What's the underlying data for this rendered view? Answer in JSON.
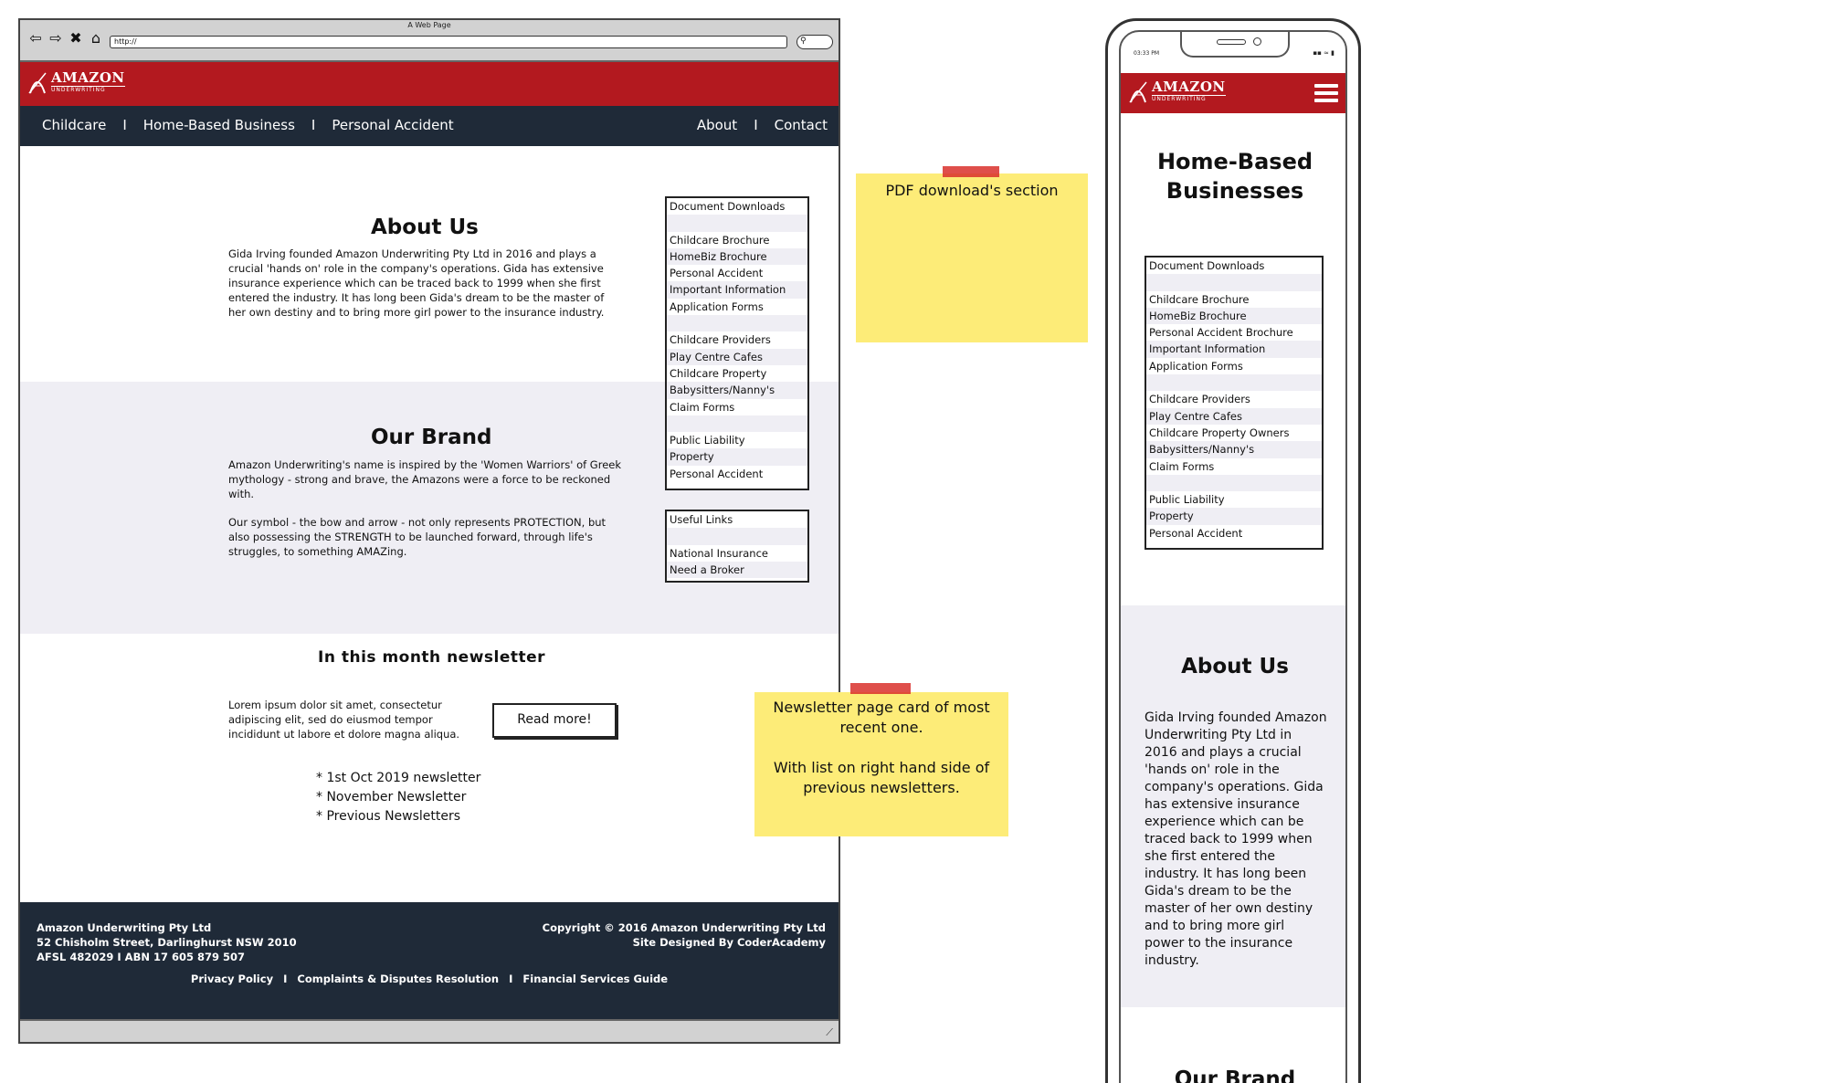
{
  "browser": {
    "window_title": "A Web Page",
    "url": "http://",
    "nav_icons": [
      "back-icon",
      "forward-icon",
      "close-icon",
      "home-icon"
    ]
  },
  "brand": {
    "name": "AMAZON",
    "sub": "UNDERWRITING",
    "header_color": "#b3191f",
    "nav_color": "#1f2a38"
  },
  "nav": {
    "left": [
      "Childcare",
      "Home-Based Business",
      "Personal Accident"
    ],
    "right": [
      "About",
      "Contact"
    ],
    "separator": "I"
  },
  "about": {
    "title": "About Us",
    "text": "Gida Irving founded Amazon Underwriting Pty Ltd in 2016 and plays a crucial 'hands on' role in the company's operations. Gida has extensive insurance experience which can be traced back to 1999 when she first entered the industry. It has long been Gida's dream to be the master of her own destiny and to bring more girl power to the insurance industry."
  },
  "brand_section": {
    "title": "Our Brand",
    "text1": "Amazon Underwriting's name is inspired by the 'Women Warriors' of Greek mythology - strong and brave, the Amazons were a force to be reckoned with.",
    "text2": "Our symbol - the bow and arrow - not only represents PROTECTION, but also possessing the STRENGTH to be launched forward, through life's struggles, to something AMAZing."
  },
  "downloads": {
    "title": "Document Downloads",
    "items": [
      "",
      "Childcare Brochure",
      "HomeBiz Brochure",
      "Personal Accident",
      "Important Information",
      "Application Forms",
      "",
      "Childcare Providers",
      "Play Centre Cafes",
      "Childcare Property",
      "Babysitters/Nanny's",
      "Claim Forms",
      "",
      "Public Liability",
      "Property",
      "Personal Accident"
    ]
  },
  "links": {
    "title": "Useful Links",
    "items": [
      "",
      "National Insurance",
      "Need a Broker"
    ]
  },
  "newsletter": {
    "title": "In this month newsletter",
    "text": "Lorem ipsum dolor sit amet, consectetur adipiscing elit, sed do eiusmod tempor incididunt ut labore et dolore magna aliqua.",
    "button": "Read more!",
    "list": [
      "* 1st Oct 2019 newsletter",
      "* November Newsletter",
      "* Previous Newsletters"
    ]
  },
  "footer": {
    "company": "Amazon Underwriting Pty Ltd",
    "address": "52 Chisholm Street, Darlinghurst NSW 2010",
    "afsl": "AFSL 482029  I  ABN 17 605 879 507",
    "copyright": "Copyright © 2016 Amazon Underwriting Pty Ltd",
    "designed": "Site Designed By CoderAcademy",
    "links": [
      "Privacy Policy",
      "Complaints & Disputes Resolution",
      "Financial Services Guide"
    ],
    "separator": "I"
  },
  "notes": {
    "pdf": "PDF download's section",
    "newsletter_line1": "Newsletter page card of most recent one.",
    "newsletter_line2": "With list on right hand side of previous newsletters.",
    "color": "#fdec78"
  },
  "mobile": {
    "time": "03:33 PM",
    "status": "▪▪ ≈ ▮",
    "page_title": "Home-Based Businesses",
    "downloads_title": "Document Downloads",
    "downloads_items": [
      "",
      "Childcare Brochure",
      "HomeBiz Brochure",
      "Personal Accident Brochure",
      "Important Information",
      "Application Forms",
      "",
      "Childcare Providers",
      "Play Centre Cafes",
      "Childcare Property Owners",
      "Babysitters/Nanny's",
      "Claim Forms",
      "",
      "Public Liability",
      "Property",
      "Personal Accident"
    ],
    "about_title": "About Us",
    "about_text": "Gida Irving founded Amazon Underwriting Pty Ltd in 2016 and plays a crucial 'hands on' role in the company's operations. Gida has extensive insurance experience which can be traced back to 1999 when she first entered the industry. It has long been Gida's dream to be the master of her own destiny and to bring more girl power to the insurance industry.",
    "brand_title": "Our Brand"
  }
}
